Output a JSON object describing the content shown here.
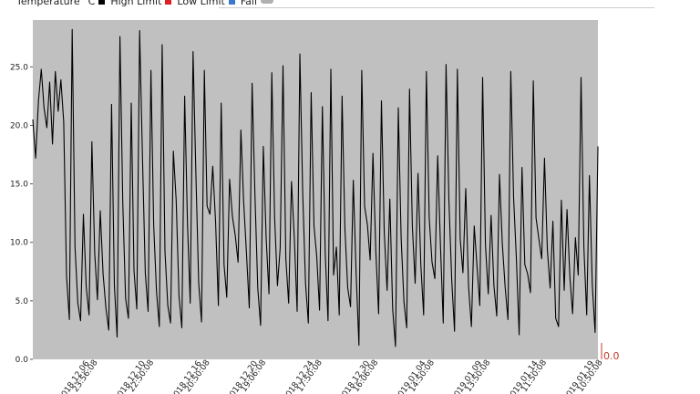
{
  "legend": [
    {
      "label": "Temperature °C",
      "color": "#000000",
      "shape": "square"
    },
    {
      "label": "High Limit",
      "color": "#e02020",
      "shape": "square"
    },
    {
      "label": "Low Limit",
      "color": "#3a78d0",
      "shape": "square"
    },
    {
      "label": "Fail",
      "color": "#b0b0b0",
      "shape": "pill"
    }
  ],
  "corner_label": "0.0",
  "chart_data": {
    "type": "line",
    "title": "",
    "xlabel": "",
    "ylabel": "",
    "ylim": [
      0,
      29
    ],
    "yticks": [
      0,
      5,
      10,
      15,
      20,
      25
    ],
    "ytick_labels": [
      "0.0",
      "5.0",
      "10.0",
      "15.0",
      "20.0",
      "25.0"
    ],
    "plot_background": "#c0c0c0",
    "grid": false,
    "legend_position": "top-left",
    "x_ticks": [
      {
        "date": "2018.12.06",
        "time": "23:56:08"
      },
      {
        "date": "2018.12.10",
        "time": "22:50:08"
      },
      {
        "date": "2018.12.16",
        "time": "20:50:08"
      },
      {
        "date": "2018.12.20",
        "time": "19:06:08"
      },
      {
        "date": "2018.12.24",
        "time": "17:50:08"
      },
      {
        "date": "2018.12.30",
        "time": "16:06:08"
      },
      {
        "date": "2019.01.04",
        "time": "14:50:08"
      },
      {
        "date": "2019.01.09",
        "time": "13:50:08"
      },
      {
        "date": "2019.01.14",
        "time": "11:50:08"
      },
      {
        "date": "2019.01.19",
        "time": "10:50:08"
      }
    ],
    "series": [
      {
        "name": "Temperature °C",
        "color": "#000000",
        "values": [
          20.5,
          17.2,
          22.1,
          24.8,
          21.5,
          19.8,
          23.7,
          18.4,
          24.6,
          21.2,
          23.9,
          20.3,
          7.1,
          3.4,
          28.2,
          9.6,
          4.8,
          3.3,
          12.4,
          6.2,
          3.8,
          18.6,
          9.1,
          5.1,
          12.7,
          7.3,
          4.4,
          2.5,
          21.8,
          6.3,
          1.9,
          27.6,
          13.4,
          5.2,
          3.5,
          21.9,
          7.6,
          4.3,
          28.1,
          17.3,
          7.4,
          4.1,
          24.7,
          11.5,
          5.8,
          2.8,
          26.9,
          9.2,
          4.6,
          3.1,
          17.8,
          13.6,
          5.4,
          2.7,
          22.5,
          11.6,
          4.8,
          26.3,
          15.9,
          6.5,
          3.2,
          24.7,
          13.1,
          12.4,
          16.5,
          11.8,
          4.6,
          21.9,
          8.1,
          5.3,
          15.4,
          12.2,
          10.6,
          8.3,
          19.6,
          13.5,
          9.1,
          4.4,
          23.6,
          14.1,
          6.1,
          2.9,
          18.2,
          10.4,
          5.6,
          24.5,
          12.1,
          6.3,
          9.5,
          25.1,
          8.6,
          4.8,
          15.2,
          10.4,
          4.1,
          26.1,
          14.3,
          6.5,
          3.1,
          22.8,
          11.4,
          8.8,
          4.2,
          21.6,
          9.1,
          3.3,
          24.8,
          7.2,
          9.6,
          3.8,
          22.5,
          11.2,
          6.1,
          4.5,
          15.3,
          7.4,
          1.2,
          24.7,
          13.1,
          11.5,
          8.5,
          17.6,
          9.3,
          3.9,
          22.1,
          10.8,
          5.9,
          13.7,
          4.3,
          1.1,
          21.5,
          10.4,
          4.9,
          2.7,
          23.1,
          11.4,
          6.5,
          15.9,
          8.1,
          3.8,
          24.6,
          12.1,
          8.3,
          6.9,
          17.4,
          9.6,
          3.1,
          25.2,
          13.6,
          6.8,
          2.4,
          24.8,
          10.3,
          7.4,
          14.6,
          6.2,
          2.8,
          11.4,
          7.9,
          4.6,
          24.1,
          9.8,
          5.6,
          12.3,
          6.3,
          3.7,
          15.8,
          9.9,
          6.2,
          3.4,
          24.6,
          13.8,
          8.7,
          2.1,
          16.4,
          8.1,
          7.3,
          5.7,
          23.8,
          12.1,
          10.3,
          8.6,
          17.2,
          9.4,
          6.1,
          11.8,
          3.5,
          2.8,
          13.6,
          5.9,
          12.8,
          7.1,
          3.9,
          10.4,
          7.2,
          24.1,
          9.6,
          3.8,
          15.7,
          6.4,
          2.3,
          18.2
        ]
      }
    ]
  }
}
